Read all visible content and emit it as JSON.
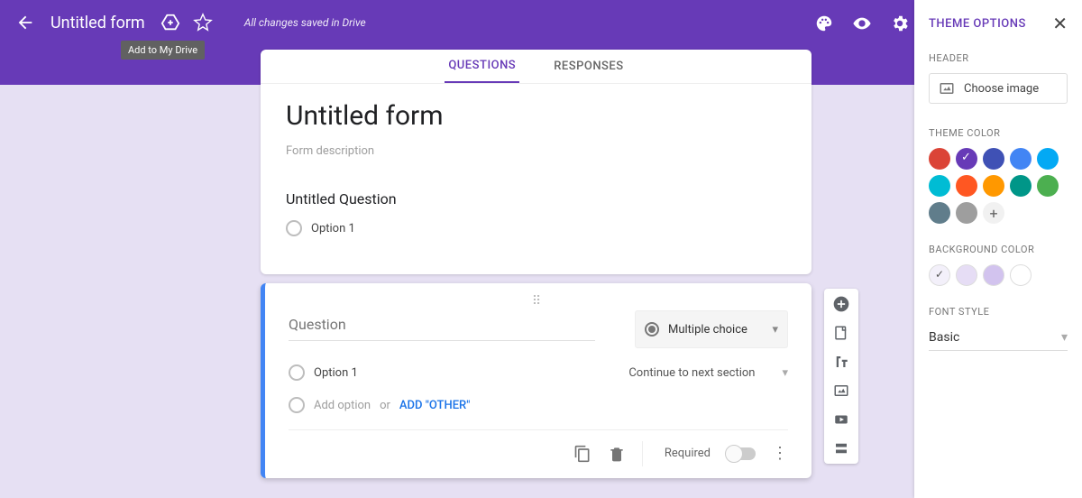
{
  "header": {
    "title": "Untitled form",
    "saved": "All changes saved in Drive",
    "tooltip": "Add to My Drive"
  },
  "tabs": {
    "questions": "QUESTIONS",
    "responses": "RESPONSES"
  },
  "form": {
    "title": "Untitled form",
    "description_placeholder": "Form description"
  },
  "q1": {
    "title": "Untitled Question",
    "option1": "Option 1"
  },
  "q2": {
    "placeholder": "Question",
    "type": "Multiple choice",
    "option1": "Option 1",
    "goto": "Continue to next section",
    "addOption": "Add option",
    "or": "  or  ",
    "addOther": "ADD \"OTHER\"",
    "required": "Required"
  },
  "themePanel": {
    "title": "THEME OPTIONS",
    "headerSection": "HEADER",
    "chooseImage": "Choose image",
    "themeColor": "THEME COLOR",
    "bgColor": "BACKGROUND COLOR",
    "fontStyle": "FONT STYLE",
    "font": "Basic",
    "colors": [
      "#db4437",
      "#673ab7",
      "#3f51b5",
      "#4285f4",
      "#03a9f4",
      "#00bcd4",
      "#ff5722",
      "#ff9800",
      "#009688",
      "#4caf50",
      "#607d8b",
      "#9e9e9e"
    ],
    "selectedColorIndex": 1,
    "bgColors": [
      "#f3f0fa",
      "#e6ddf5",
      "#d2c3ee",
      "#ffffff"
    ],
    "selectedBgIndex": 0
  }
}
